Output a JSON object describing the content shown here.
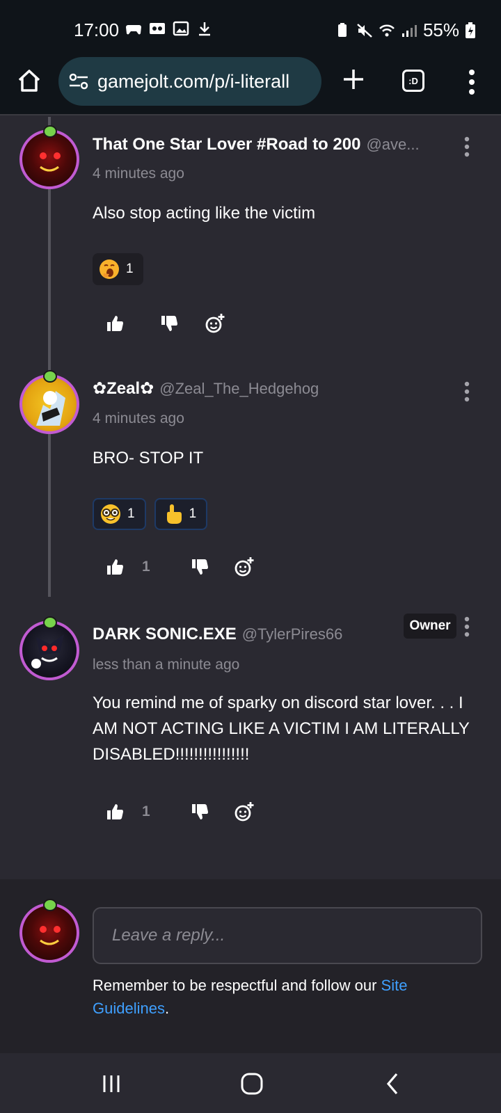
{
  "status_bar": {
    "time": "17:00",
    "battery": "55%",
    "left_icons": [
      "game-controller-icon",
      "voicemail-icon",
      "gallery-icon",
      "download-icon"
    ],
    "right_icons": [
      "battery-saver-icon",
      "mute-icon",
      "wifi-icon",
      "signal-icon"
    ]
  },
  "browser": {
    "url": "gamejolt.com/p/i-literall",
    "tab_label": ":D"
  },
  "comments": [
    {
      "name": "That One Star Lover #Road to 200",
      "handle": "@ave...",
      "time": "4 minutes ago",
      "body": "Also stop acting like the victim",
      "reactions": [
        {
          "emoji": "yawning-face-icon",
          "count": "1"
        }
      ],
      "likes": ""
    },
    {
      "name": "✿Zeal✿",
      "handle": "@Zeal_The_Hedgehog",
      "time": "4 minutes ago",
      "body": "BRO- STOP IT",
      "reactions": [
        {
          "emoji": "nerd-face-icon",
          "count": "1"
        },
        {
          "emoji": "pointing-finger-icon",
          "count": "1"
        }
      ],
      "likes": "1"
    },
    {
      "name": "DARK SONIC.EXE",
      "handle": "@TylerPires66",
      "badge": "Owner",
      "time": "less than a minute ago",
      "body": "You remind me of sparky on discord star lover. . . I AM NOT ACTING LIKE A VICTIM I AM LITERALLY DISABLED!!!!!!!!!!!!!!!!",
      "likes": "1"
    }
  ],
  "reply": {
    "placeholder": "Leave a reply...",
    "note_prefix": "Remember to be respectful and follow our ",
    "note_link": "Site Guidelines",
    "note_suffix": "."
  },
  "colors": {
    "background": "#2a2931",
    "avatar_ring": "#c15bd2",
    "link": "#3fa0ff",
    "url_pill": "#1f3a44"
  }
}
